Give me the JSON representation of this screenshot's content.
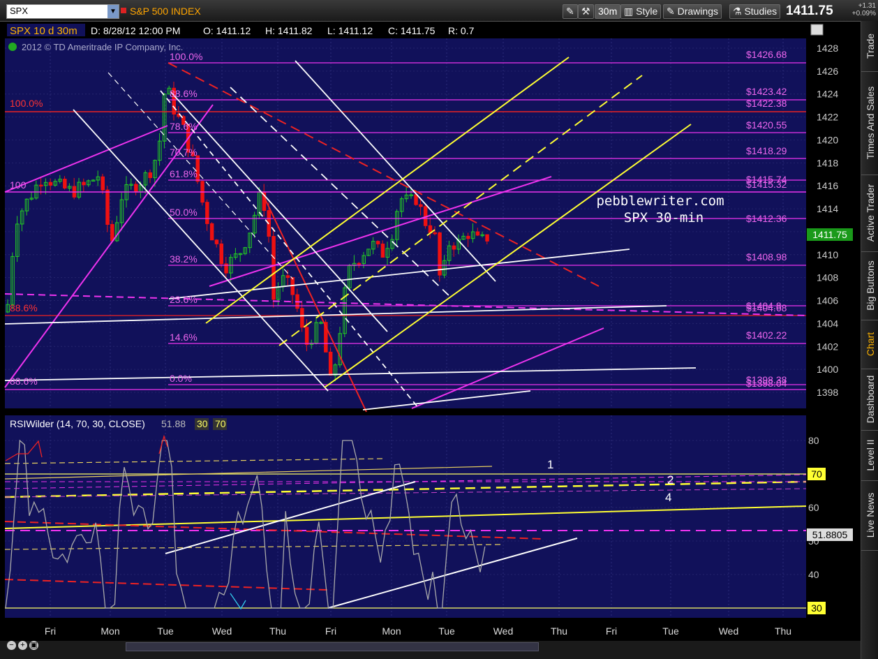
{
  "toolbar": {
    "symbol": "SPX",
    "symbol_name": "S&P 500 INDEX",
    "timeframe": "30m",
    "style_label": "Style",
    "drawings_label": "Drawings",
    "studies_label": "Studies",
    "last_price": "1411.75",
    "change": "+1.31",
    "change_pct": "+0.09%"
  },
  "sidebar": {
    "tabs": [
      "Trade",
      "Times And Sales",
      "Active Trader",
      "Big Buttons",
      "Chart",
      "Dashboard",
      "Level II",
      "Live News"
    ],
    "active": "Chart"
  },
  "header": {
    "symbol_period": "SPX 10 d 30m",
    "date": "D: 8/28/12 12:00 PM",
    "open": "O: 1411.12",
    "high": "H: 1411.82",
    "low": "L: 1411.12",
    "close": "C: 1411.75",
    "range": "R: 0.7",
    "copyright": "2012 © TD Ameritrade IP Company, Inc."
  },
  "price_axis": {
    "ticks": [
      "1428",
      "1426",
      "1424",
      "1422",
      "1420",
      "1418",
      "1416",
      "1414",
      "1412",
      "1410",
      "1408",
      "1406",
      "1404",
      "1402",
      "1400",
      "1398"
    ],
    "current": "1411.75"
  },
  "rsi": {
    "label": "RSIWilder (14, 70, 30, CLOSE)",
    "value": "51.88",
    "ob": "30",
    "os": "70",
    "ticks": [
      "80",
      "70",
      "60",
      "50",
      "40",
      "30"
    ],
    "current": "51.8805",
    "ob_level": "70",
    "os_level": "30",
    "notes": [
      "1",
      "2",
      "4"
    ]
  },
  "fib_labels": [
    "100.0%",
    "88.6%",
    "78.6%",
    "70.7%",
    "61.8%",
    "50.0%",
    "38.2%",
    "23.6%",
    "14.6%",
    "0.0%"
  ],
  "red_fib": [
    "100.0%",
    "88.6%"
  ],
  "left_fib": [
    "100",
    "88.6%"
  ],
  "price_levels": [
    "$1426.68",
    "$1423.42",
    "$1422.38",
    "$1420.55",
    "$1418.29",
    "$1415.74",
    "$1415.32",
    "$1412.36",
    "$1408.98",
    "$1404.8",
    "$1404.68",
    "$1402.22",
    "$1398.38",
    "$1398.04"
  ],
  "watermark": {
    "line1": "pebblewriter.com",
    "line2": "SPX 30-min"
  },
  "time_axis": [
    "Fri",
    "Mon",
    "Tue",
    "Wed",
    "Thu",
    "Fri",
    "Mon",
    "Tue",
    "Wed",
    "Thu",
    "Fri",
    "Tue",
    "Wed",
    "Thu"
  ],
  "colors": {
    "bg": "#11115a",
    "up": "#22cc22",
    "down": "#ee1111",
    "fib": "#ee33ee",
    "channel": "#ffff33",
    "accent": "#ffb400"
  }
}
